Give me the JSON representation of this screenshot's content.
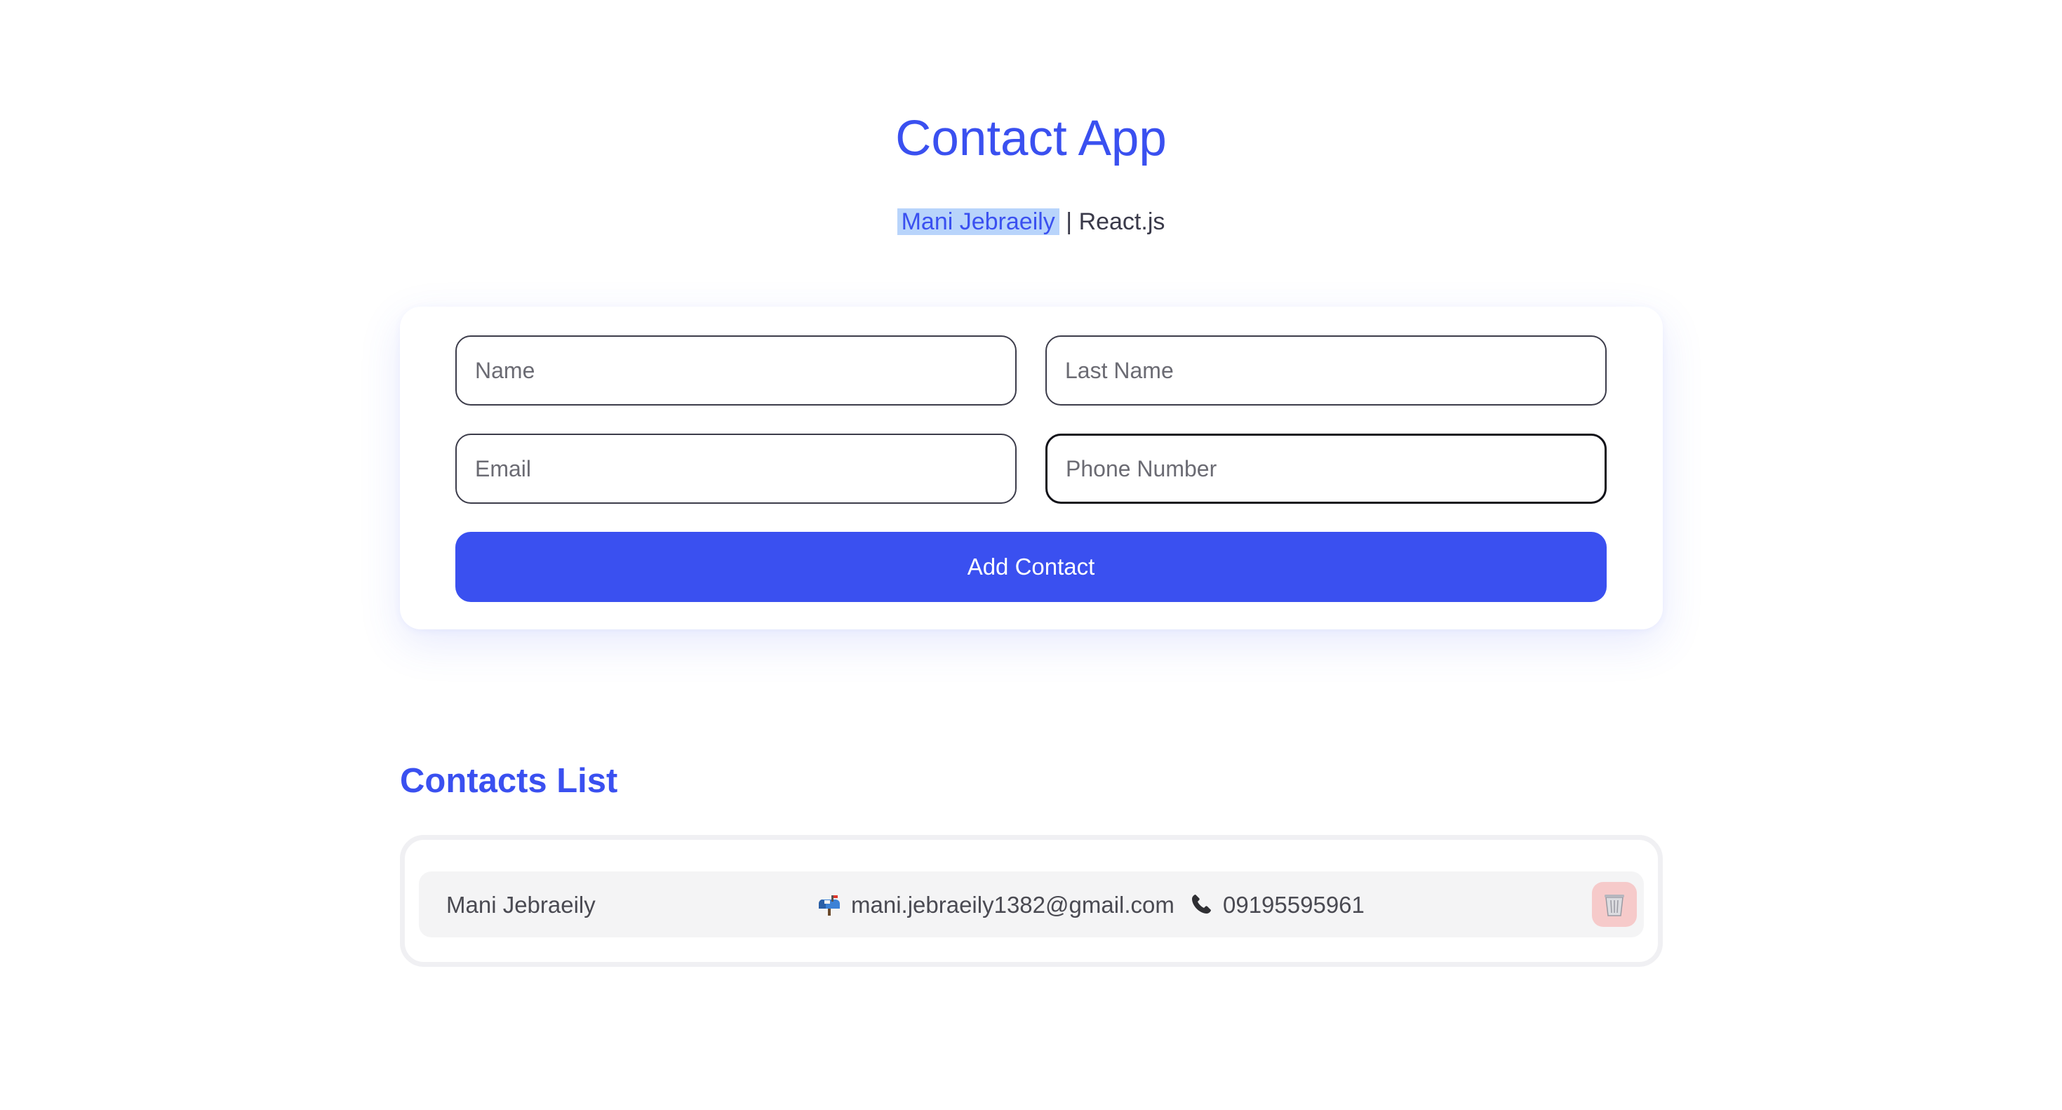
{
  "header": {
    "title": "Contact App",
    "author": "Mani Jebraeily",
    "separator": "|",
    "tech": "React.js"
  },
  "form": {
    "name_placeholder": "Name",
    "last_name_placeholder": "Last Name",
    "email_placeholder": "Email",
    "phone_placeholder": "Phone Number",
    "submit_label": "Add Contact"
  },
  "contacts": {
    "heading": "Contacts List",
    "items": [
      {
        "name": "Mani Jebraeily",
        "email": "mani.jebraeily1382@gmail.com",
        "phone": "09195595961"
      }
    ]
  },
  "colors": {
    "accent": "#3a50f0",
    "delete_bg": "#f6caca",
    "row_bg": "#f4f4f5"
  },
  "icons": {
    "email": "mailbox-icon",
    "phone": "phone-icon",
    "delete": "trash-icon"
  }
}
